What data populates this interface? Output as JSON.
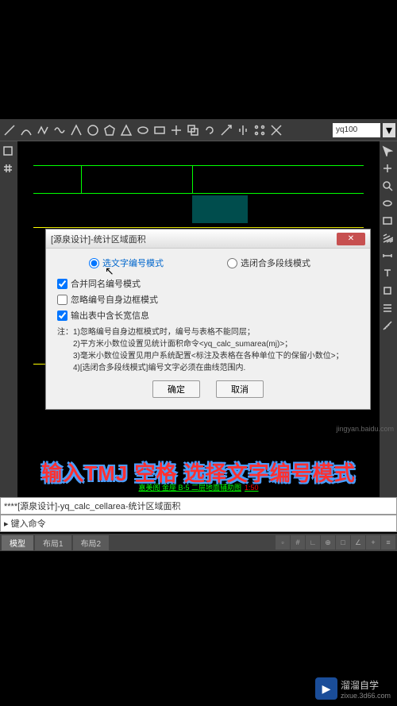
{
  "toolbar": {
    "search_value": "yq100"
  },
  "drawing": {
    "label": "嘉美阁 金座 B-5 二层地面辅助图",
    "scale": "1:50"
  },
  "dialog": {
    "title": "[源泉设计]-统计区域面积",
    "radio1": "选文字编号模式",
    "radio2": "选闭合多段线模式",
    "check1": "合并同名编号模式",
    "check2": "忽略编号自身边框模式",
    "check3": "输出表中含长宽信息",
    "notes_label": "注：",
    "note1": "1)忽略编号自身边框模式时，编号与表格不能同层；",
    "note2": "2)平方米小数位设置见统计面积命令<yq_calc_sumarea(mj)>；",
    "note3": "3)毫米小数位设置见用户系统配置<标注及表格在各种单位下的保留小数位>；",
    "note4": "4)[选闭合多段线模式]编号文字必须在曲线范围内.",
    "ok": "确定",
    "cancel": "取消"
  },
  "caption": "输入TMJ 空格 选择文字编号模式",
  "command": {
    "line1": "****[源泉设计]-yq_calc_cellarea-统计区域面积",
    "input_prefix": "▸ 键入命令"
  },
  "tabs": {
    "tab1": "模型",
    "tab2": "布局1",
    "tab3": "布局2"
  },
  "watermark": {
    "brand": "溜溜自学",
    "url": "zixue.3d66.com",
    "side": "jingyan.baidu.com"
  }
}
